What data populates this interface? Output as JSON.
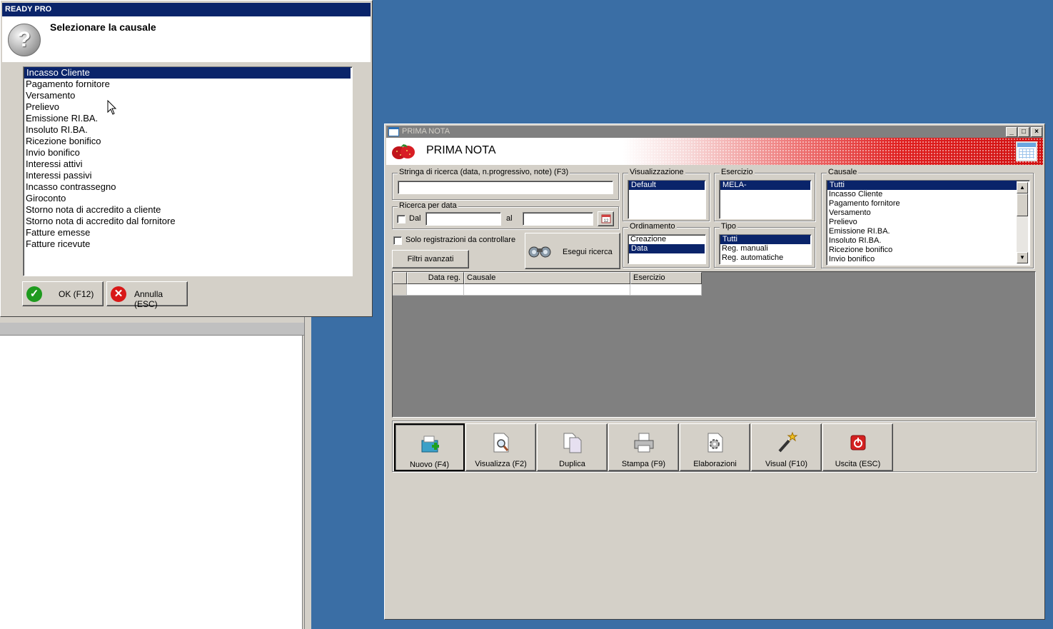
{
  "dialog": {
    "title": "READY PRO",
    "prompt": "Selezionare la causale",
    "items": [
      "Incasso Cliente",
      "Pagamento fornitore",
      "Versamento",
      "Prelievo",
      "Emissione RI.BA.",
      "Insoluto RI.BA.",
      "Ricezione bonifico",
      "Invio bonifico",
      "Interessi attivi",
      "Interessi passivi",
      "Incasso contrassegno",
      "Giroconto",
      "Storno nota di accredito a cliente",
      "Storno nota di accredito dal fornitore",
      "Fatture emesse",
      "Fatture ricevute"
    ],
    "selected_index": 0,
    "ok_label": "OK (F12)",
    "cancel_label": "Annulla (ESC)"
  },
  "prima_nota": {
    "window_title": "PRIMA NOTA",
    "banner_title": "PRIMA NOTA",
    "search": {
      "label": "Stringa di ricerca (data, n.progressivo, note) (F3)",
      "value": ""
    },
    "date_search": {
      "label": "Ricerca per data",
      "from_label": "Dal",
      "to_label": "al",
      "from_value": "",
      "to_value": "",
      "from_checked": false
    },
    "only_to_check_label": "Solo registrazioni da controllare",
    "advanced_filters_label": "Filtri avanzati",
    "search_button_label": "Esegui ricerca",
    "visualizzazione": {
      "label": "Visualizzazione",
      "items": [
        "Default"
      ],
      "selected": 0
    },
    "esercizio": {
      "label": "Esercizio",
      "items": [
        "MELA-"
      ],
      "selected": 0
    },
    "ordinamento": {
      "label": "Ordinamento",
      "items": [
        "Creazione",
        "Data"
      ],
      "selected": 1
    },
    "tipo": {
      "label": "Tipo",
      "items": [
        "Tutti",
        "Reg. manuali",
        "Reg. automatiche"
      ],
      "selected": 0
    },
    "causale": {
      "label": "Causale",
      "items": [
        "Tutti",
        "Incasso Cliente",
        "Pagamento fornitore",
        "Versamento",
        "Prelievo",
        "Emissione RI.BA.",
        "Insoluto RI.BA.",
        "Ricezione bonifico",
        "Invio bonifico"
      ],
      "selected": 0
    },
    "grid": {
      "columns": [
        "",
        "Data reg.",
        "Causale",
        "Esercizio"
      ],
      "rows": [
        [
          "",
          "",
          "",
          ""
        ]
      ]
    },
    "toolbar": [
      {
        "label": "Nuovo (F4)",
        "icon": "new-record-icon",
        "pressed": true
      },
      {
        "label": "Visualizza (F2)",
        "icon": "view-document-icon",
        "pressed": false
      },
      {
        "label": "Duplica",
        "icon": "duplicate-icon",
        "pressed": false
      },
      {
        "label": "Stampa (F9)",
        "icon": "printer-icon",
        "pressed": false
      },
      {
        "label": "Elaborazioni",
        "icon": "processing-icon",
        "pressed": false
      },
      {
        "label": "Visual (F10)",
        "icon": "magic-wand-icon",
        "pressed": false
      },
      {
        "label": "Uscita (ESC)",
        "icon": "exit-icon",
        "pressed": false
      }
    ]
  },
  "colors": {
    "desktop": "#3a6ea5",
    "selection": "#0a246a",
    "face": "#d4d0c8",
    "banner_red": "#e02020"
  }
}
